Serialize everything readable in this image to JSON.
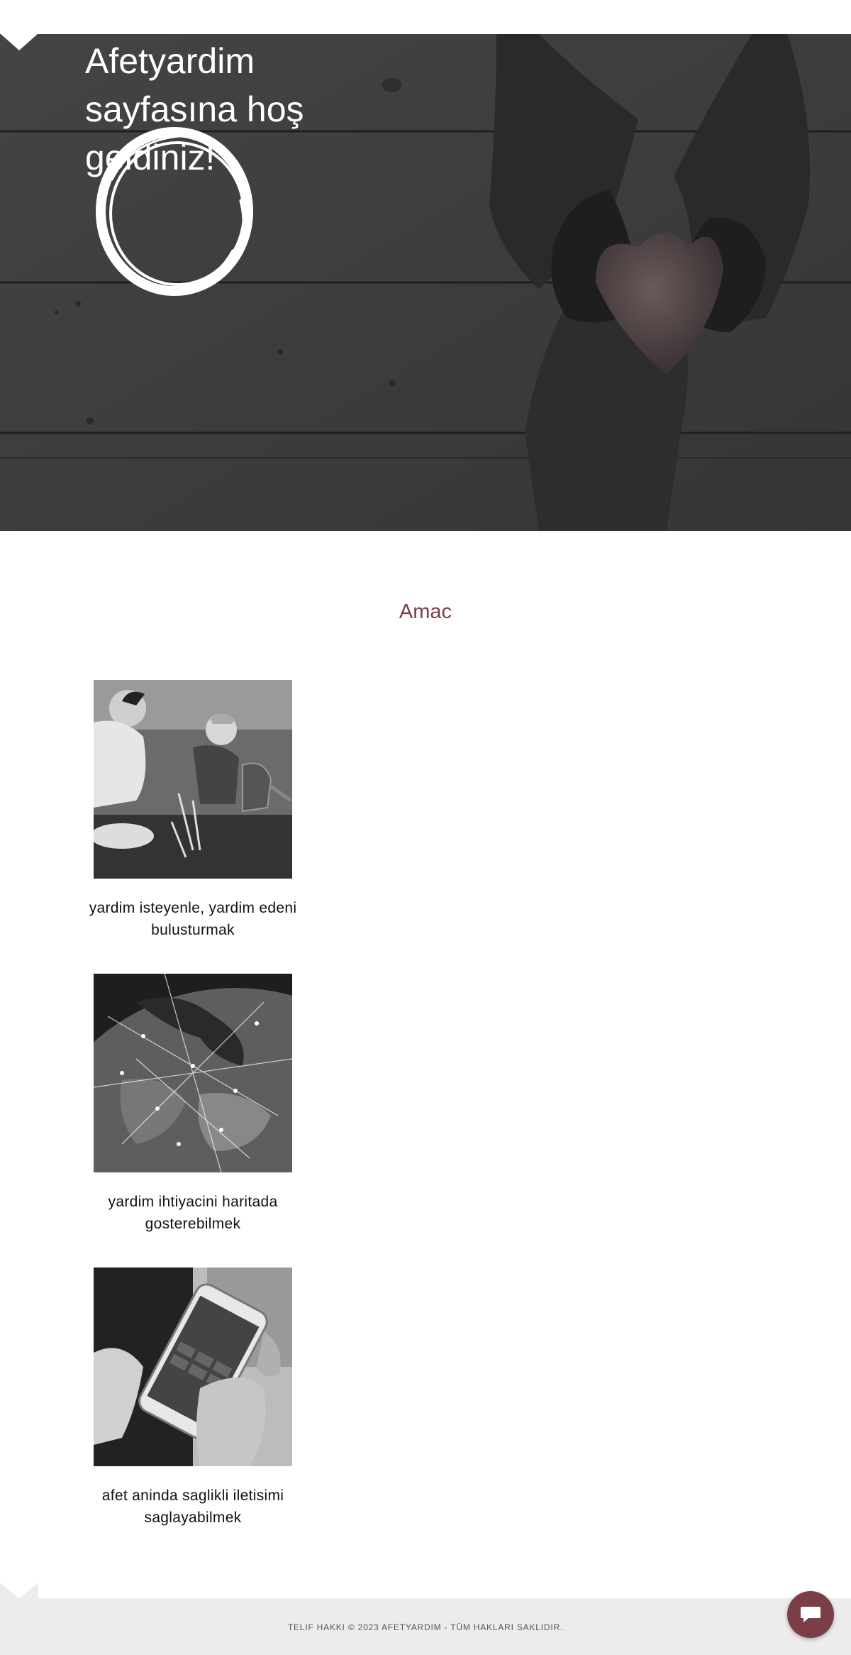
{
  "hero": {
    "title": "Afetyardim sayfasına hoş geldiniz!"
  },
  "purpose": {
    "title": "Amac",
    "items": [
      {
        "text": "yardim isteyenle, yardim edeni bulusturmak",
        "image": "father-and-child-gardening-photo"
      },
      {
        "text": "yardim ihtiyacini haritada gosterebilmek",
        "image": "earth-network-lights-photo"
      },
      {
        "text": "afet aninda saglikli iletisimi saglayabilmek",
        "image": "hands-holding-smartphone-photo"
      }
    ]
  },
  "footer": {
    "copyright": "TELIF HAKKI © 2023 AFETYARDIM - TÜM HAKLARI SAKLIDIR."
  },
  "chat": {
    "icon": "chat-bubble-icon"
  },
  "colors": {
    "accent": "#7b3e46",
    "hero_bg": "#3c3b3c",
    "footer_bg": "#ececec"
  }
}
